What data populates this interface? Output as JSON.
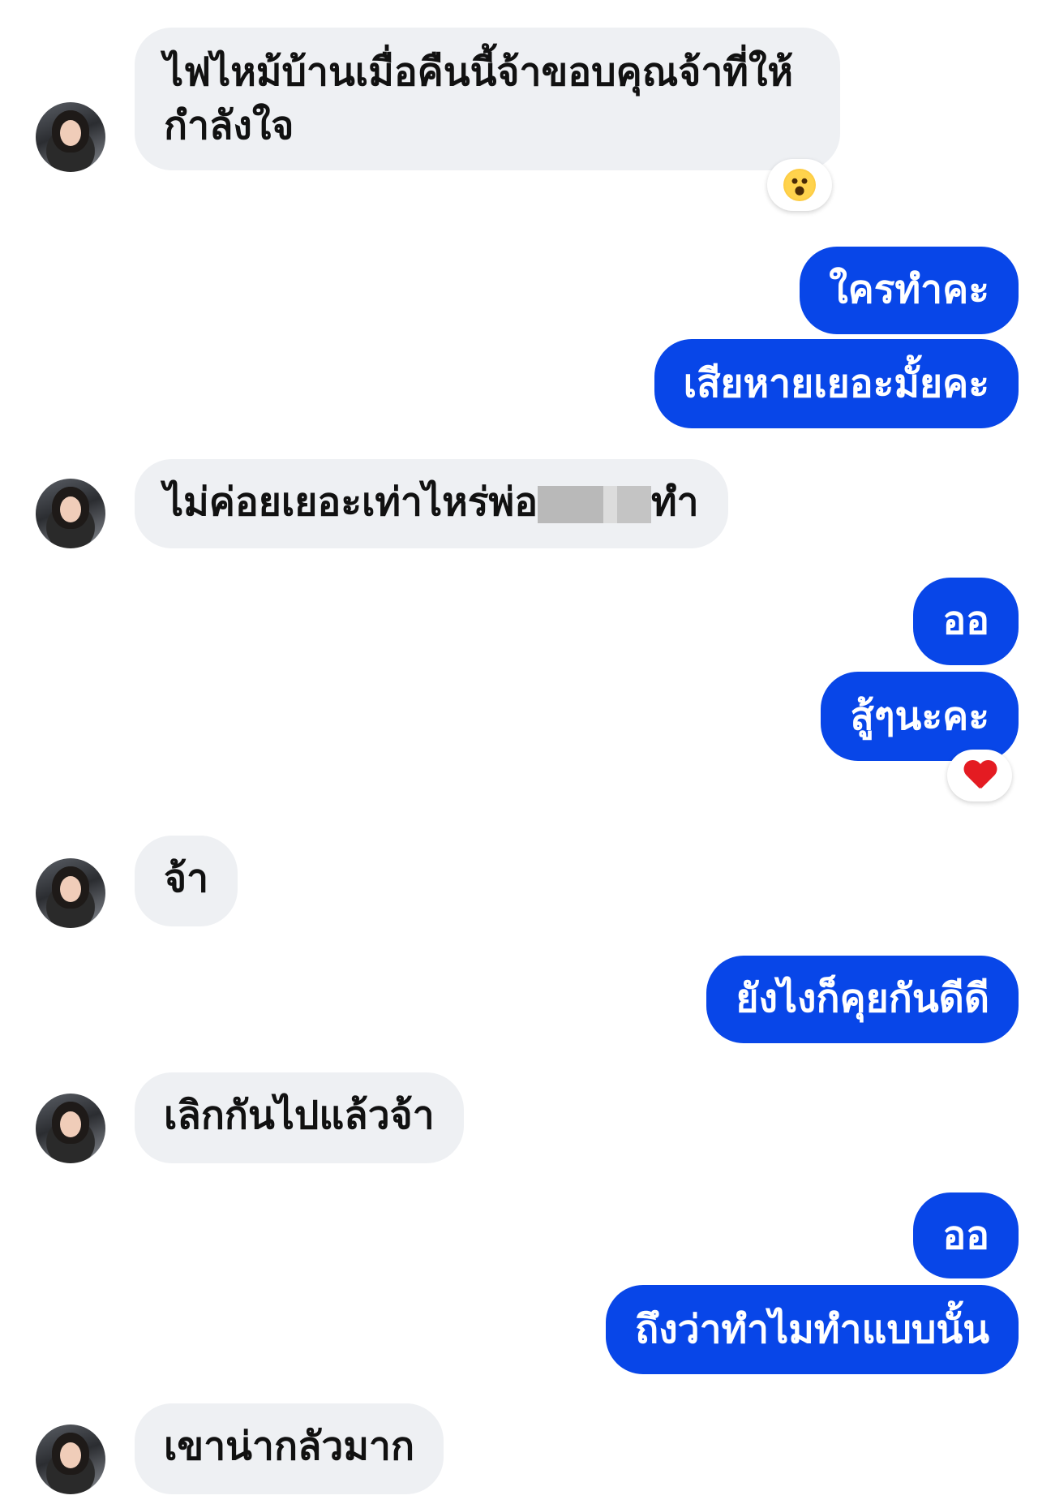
{
  "messages": [
    {
      "side": "incoming",
      "text": "ไฟไหม้บ้านเมื่อคืนนี้จ้าขอบคุณจ้าที่ให้กำลังใจ",
      "reaction": "wow-icon"
    },
    {
      "side": "outgoing",
      "text": "ใครทำคะ"
    },
    {
      "side": "outgoing",
      "text": "เสียหายเยอะมั้ยคะ"
    },
    {
      "side": "incoming",
      "text_before": "ไม่ค่อยเยอะเท่าไหร่พ่อ",
      "text_after": "ทำ"
    },
    {
      "side": "outgoing",
      "text": "ออ"
    },
    {
      "side": "outgoing",
      "text": "สู้ๆนะคะ",
      "reaction": "heart-icon"
    },
    {
      "side": "incoming",
      "text": "จ้า"
    },
    {
      "side": "outgoing",
      "text": "ยังไงก็คุยกันดีดี"
    },
    {
      "side": "incoming",
      "text": "เลิกกันไปแล้วจ้า"
    },
    {
      "side": "outgoing",
      "text": "ออ"
    },
    {
      "side": "outgoing",
      "text": "ถึงว่าทำไมทำแบบนั้น"
    },
    {
      "side": "incoming",
      "text": "เขาน่ากลัวมาก"
    }
  ],
  "colors": {
    "outgoing_bubble": "#0846e8",
    "incoming_bubble": "#eef0f3",
    "reaction_heart": "#e41b22"
  }
}
